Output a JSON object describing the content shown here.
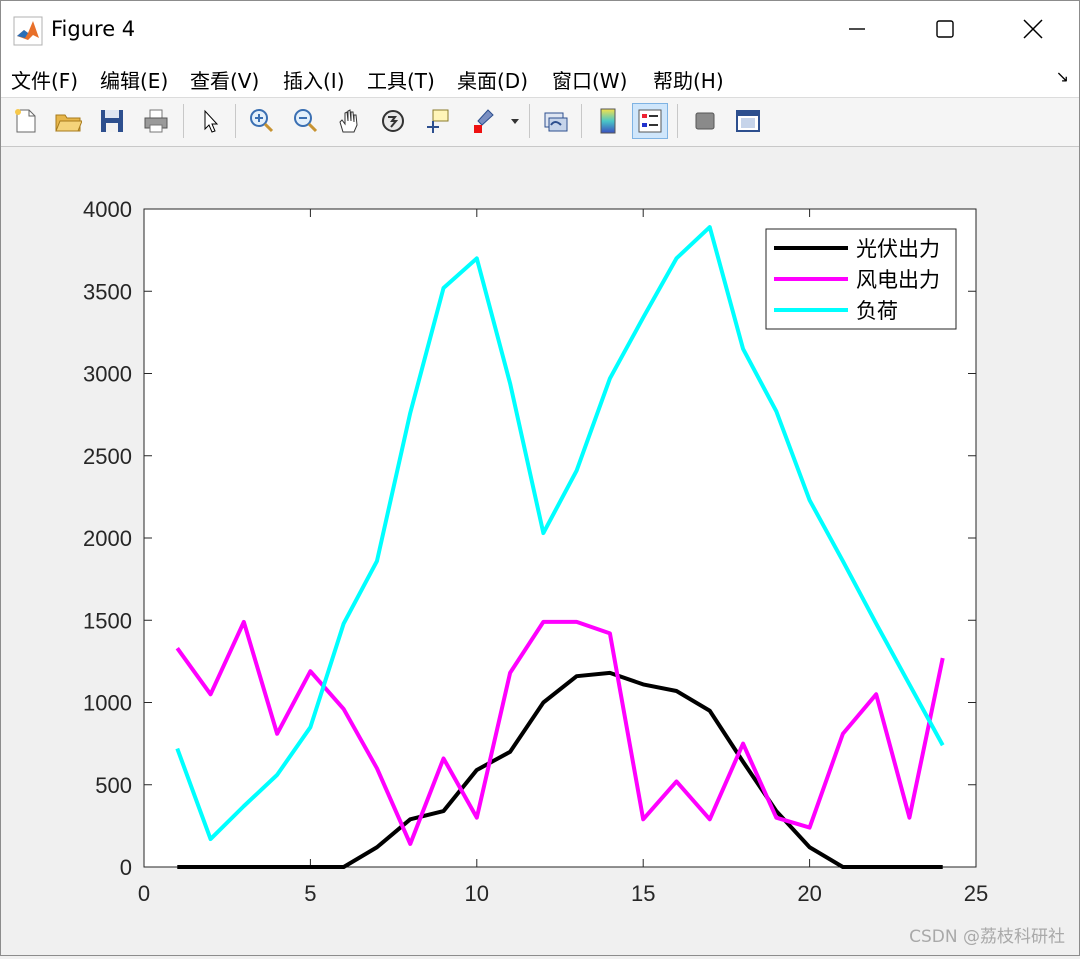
{
  "window": {
    "title": "Figure 4",
    "controls": [
      "minimize",
      "maximize",
      "close"
    ]
  },
  "menu": [
    "文件(F)",
    "编辑(E)",
    "查看(V)",
    "插入(I)",
    "工具(T)",
    "桌面(D)",
    "窗口(W)",
    "帮助(H)"
  ],
  "toolbar": {
    "icons": [
      "new-figure-icon",
      "open-file-icon",
      "save-icon",
      "print-icon",
      "pointer-icon",
      "zoom-in-icon",
      "zoom-out-icon",
      "pan-hand-icon",
      "rotate-3d-icon",
      "data-cursor-icon",
      "brush-icon",
      "link-plot-icon",
      "insert-colorbar-icon",
      "insert-legend-icon",
      "hide-plot-tools-icon",
      "show-plot-tools-icon"
    ]
  },
  "watermark": "CSDN @荔枝科研社",
  "chart_data": {
    "type": "line",
    "title": "",
    "xlabel": "",
    "ylabel": "",
    "xlim": [
      0,
      25
    ],
    "ylim": [
      0,
      4000
    ],
    "xticks": [
      "0",
      "5",
      "10",
      "15",
      "20",
      "25"
    ],
    "yticks": [
      "0",
      "500",
      "1000",
      "1500",
      "2000",
      "2500",
      "3000",
      "3500",
      "4000"
    ],
    "grid": false,
    "legend_position": "top-right",
    "x": [
      1,
      2,
      3,
      4,
      5,
      6,
      7,
      8,
      9,
      10,
      11,
      12,
      13,
      14,
      15,
      16,
      17,
      18,
      19,
      20,
      21,
      22,
      23,
      24
    ],
    "series": [
      {
        "name": "光伏出力",
        "color": "#000000",
        "values": [
          0,
          0,
          0,
          0,
          0,
          0,
          120,
          290,
          340,
          590,
          700,
          1000,
          1160,
          1180,
          1110,
          1070,
          950,
          640,
          340,
          120,
          0,
          0,
          0,
          0
        ]
      },
      {
        "name": "风电出力",
        "color": "#ff00ff",
        "values": [
          1330,
          1050,
          1490,
          810,
          1190,
          960,
          600,
          140,
          660,
          300,
          1180,
          1490,
          1490,
          1420,
          290,
          520,
          290,
          750,
          300,
          240,
          810,
          1050,
          300,
          1270
        ]
      },
      {
        "name": "负荷",
        "color": "#00ffff",
        "values": [
          720,
          170,
          370,
          560,
          850,
          1480,
          1860,
          2760,
          3520,
          3700,
          2940,
          2030,
          2410,
          2970,
          3340,
          3700,
          3890,
          3150,
          2770,
          2230,
          1860,
          1480,
          1110,
          740
        ]
      }
    ]
  }
}
